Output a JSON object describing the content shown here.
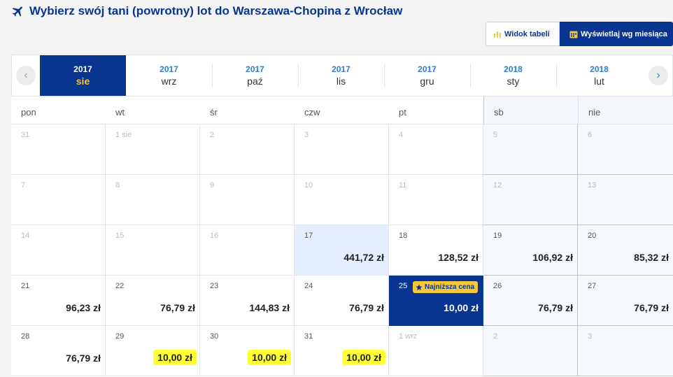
{
  "header": {
    "title": "Wybierz swój tani (powrotny) lot do Warszawa-Chopina z Wrocław",
    "plane_icon": "plane-icon"
  },
  "view_toggle": {
    "table_label": "Widok tabeli",
    "month_label": "Wyświetlaj wg miesiąca",
    "table_icon": "bar-chart-icon",
    "month_icon": "calendar-icon"
  },
  "month_strip": {
    "prev_icon": "chevron-left-icon",
    "next_icon": "chevron-right-icon",
    "tabs": [
      {
        "year": "2017",
        "month": "sie"
      },
      {
        "year": "2017",
        "month": "wrz"
      },
      {
        "year": "2017",
        "month": "paź"
      },
      {
        "year": "2017",
        "month": "lis"
      },
      {
        "year": "2017",
        "month": "gru"
      },
      {
        "year": "2018",
        "month": "sty"
      },
      {
        "year": "2018",
        "month": "lut"
      }
    ]
  },
  "calendar": {
    "day_headers": [
      "pon",
      "wt",
      "śr",
      "czw",
      "pt",
      "sb",
      "nie"
    ],
    "best_badge": "Najniższa cena",
    "weeks": [
      [
        {
          "d": "31",
          "p": ""
        },
        {
          "d": "1 sie",
          "p": ""
        },
        {
          "d": "2",
          "p": ""
        },
        {
          "d": "3",
          "p": ""
        },
        {
          "d": "4",
          "p": ""
        },
        {
          "d": "5",
          "p": ""
        },
        {
          "d": "6",
          "p": ""
        }
      ],
      [
        {
          "d": "7",
          "p": ""
        },
        {
          "d": "8",
          "p": ""
        },
        {
          "d": "9",
          "p": ""
        },
        {
          "d": "10",
          "p": ""
        },
        {
          "d": "11",
          "p": ""
        },
        {
          "d": "12",
          "p": ""
        },
        {
          "d": "13",
          "p": ""
        }
      ],
      [
        {
          "d": "14",
          "p": ""
        },
        {
          "d": "15",
          "p": ""
        },
        {
          "d": "16",
          "p": ""
        },
        {
          "d": "17",
          "p": "441,72 zł"
        },
        {
          "d": "18",
          "p": "128,52 zł"
        },
        {
          "d": "19",
          "p": "106,92 zł"
        },
        {
          "d": "20",
          "p": "85,32 zł"
        }
      ],
      [
        {
          "d": "21",
          "p": "96,23 zł"
        },
        {
          "d": "22",
          "p": "76,79 zł"
        },
        {
          "d": "23",
          "p": "144,83 zł"
        },
        {
          "d": "24",
          "p": "76,79 zł"
        },
        {
          "d": "25",
          "p": "10,00 zł"
        },
        {
          "d": "26",
          "p": "76,79 zł"
        },
        {
          "d": "27",
          "p": "76,79 zł"
        }
      ],
      [
        {
          "d": "28",
          "p": "76,79 zł"
        },
        {
          "d": "29",
          "p": "10,00 zł"
        },
        {
          "d": "30",
          "p": "10,00 zł"
        },
        {
          "d": "31",
          "p": "10,00 zł"
        },
        {
          "d": "1 wrz",
          "p": ""
        },
        {
          "d": "2",
          "p": ""
        },
        {
          "d": "3",
          "p": ""
        }
      ]
    ]
  }
}
